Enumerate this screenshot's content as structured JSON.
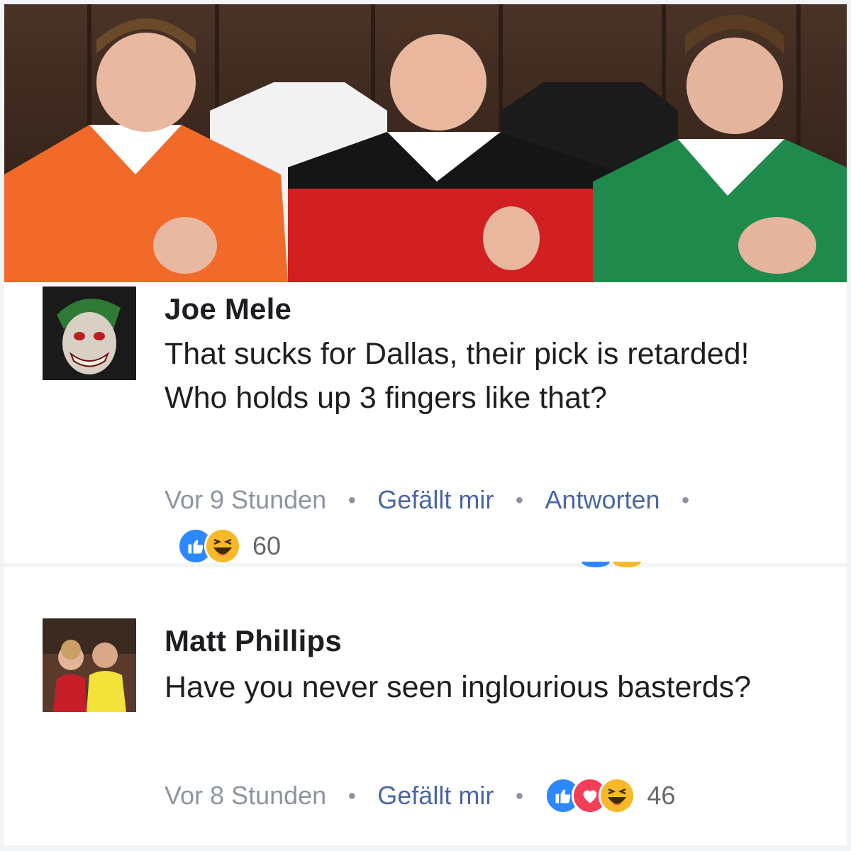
{
  "post_image": {
    "description_icon": "photo"
  },
  "comments": [
    {
      "author": "Joe Mele",
      "text": "That sucks for Dallas, their pick is retarded! Who holds up 3 fingers like that?",
      "time": "Vor 9 Stunden",
      "like_label": "Gefällt mir",
      "reply_label": "Antworten",
      "reaction_count": "60",
      "reactions": [
        "like-icon",
        "haha-icon"
      ]
    },
    {
      "author": "Matt Phillips",
      "text": "Have you never seen inglourious basterds?",
      "time": "Vor 8 Stunden",
      "like_label": "Gefällt mir",
      "reaction_count": "46",
      "reactions": [
        "like-icon",
        "love-icon",
        "haha-icon"
      ]
    }
  ],
  "colors": {
    "link": "#4b67a1",
    "meta": "#8d949e",
    "like": "#2d88ff",
    "love": "#f33e58",
    "haha": "#f7b928"
  }
}
